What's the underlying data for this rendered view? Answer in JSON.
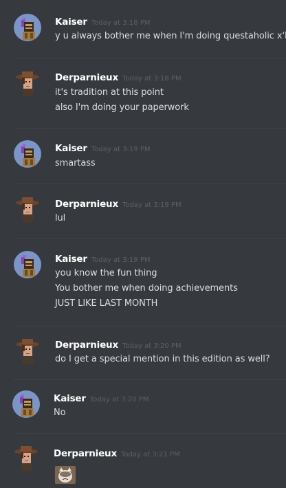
{
  "messages": [
    {
      "author": "Kaiser",
      "time": "Today at 3:18 PM",
      "avatar": "knight-avatar-icon",
      "lines": [
        "y u always bother me when I'm doing questaholic x'D"
      ]
    },
    {
      "author": "Derparnieux",
      "time": "Today at 3:18 PM",
      "avatar": "hat-man-avatar-icon",
      "lines": [
        "it's tradition at this point",
        "also I'm doing your paperwork"
      ]
    },
    {
      "author": "Kaiser",
      "time": "Today at 3:19 PM",
      "avatar": "knight-avatar-icon",
      "lines": [
        "smartass"
      ]
    },
    {
      "author": "Derparnieux",
      "time": "Today at 3:19 PM",
      "avatar": "hat-man-avatar-icon",
      "lines": [
        "lul"
      ]
    },
    {
      "author": "Kaiser",
      "time": "Today at 3:19 PM",
      "avatar": "knight-avatar-icon",
      "lines": [
        "you know the fun thing",
        "You bother me when doing achievements",
        "JUST LIKE LAST MONTH"
      ]
    },
    {
      "author": "Derparnieux",
      "time": "Today at 3:20 PM",
      "avatar": "hat-man-avatar-icon",
      "lines": [
        "do I get a special mention in this edition as well?"
      ]
    },
    {
      "author": "Kaiser",
      "time": "Today at 3:20 PM",
      "avatar": "knight-avatar-icon",
      "lines": [
        "No"
      ]
    },
    {
      "author": "Derparnieux",
      "time": "Today at 3:21 PM",
      "avatar": "hat-man-avatar-icon",
      "lines": [],
      "attachment": "grumpy-cat-image"
    }
  ],
  "colors": {
    "background": "#36393e",
    "username": "#ffffff",
    "timestamp": "#5d6066",
    "text": "#dcddde",
    "divider": "#3f4248",
    "knight_avatar_bg": "#7289da"
  }
}
